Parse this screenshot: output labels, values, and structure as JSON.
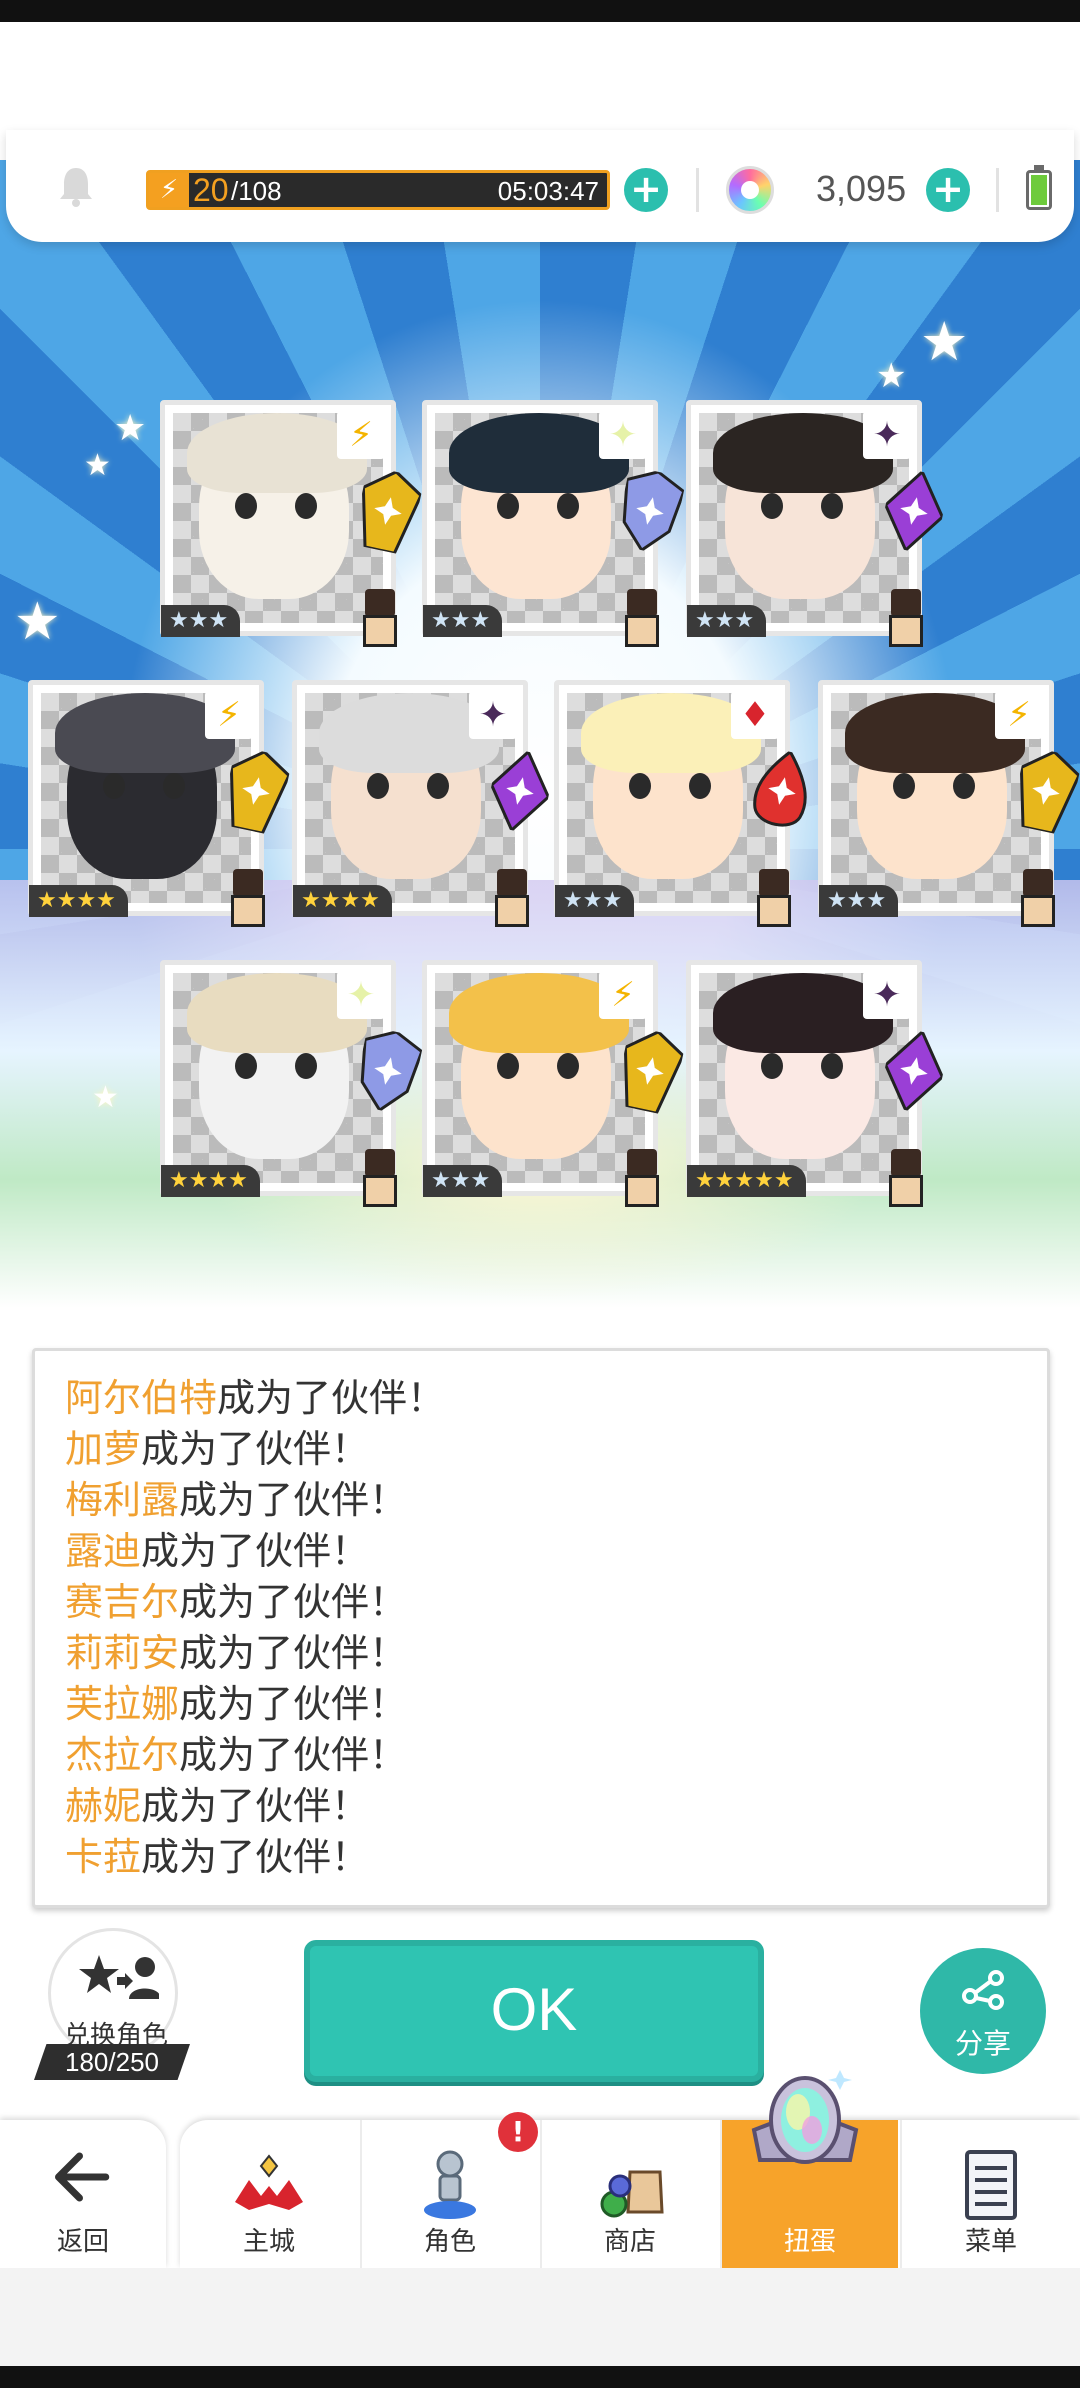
{
  "header": {
    "energy_current": "20",
    "energy_max": "/108",
    "energy_timer": "05:03:47",
    "gem_count": "3,095"
  },
  "colors": {
    "accent_teal": "#2fc4b2",
    "accent_orange": "#f7a32a",
    "name_orange": "#f0a030",
    "star_gold": "#ffd23c"
  },
  "cards": [
    {
      "element": "lightning",
      "stars": "★★★",
      "rarity": 3
    },
    {
      "element": "light",
      "stars": "★★★",
      "rarity": 3
    },
    {
      "element": "dark",
      "stars": "★★★",
      "rarity": 3
    },
    {
      "element": "lightning",
      "stars": "★★★★",
      "rarity": 4
    },
    {
      "element": "dark",
      "stars": "★★★★",
      "rarity": 4
    },
    {
      "element": "fire",
      "stars": "★★★",
      "rarity": 3
    },
    {
      "element": "lightning",
      "stars": "★★★",
      "rarity": 3
    },
    {
      "element": "light",
      "stars": "★★★★",
      "rarity": 4
    },
    {
      "element": "lightning",
      "stars": "★★★",
      "rarity": 3
    },
    {
      "element": "dark",
      "stars": "★★★★★",
      "rarity": 5
    }
  ],
  "log": [
    {
      "name": "阿尔伯特",
      "text": "成为了伙伴！"
    },
    {
      "name": "加萝",
      "text": "成为了伙伴！"
    },
    {
      "name": "梅利露",
      "text": "成为了伙伴！"
    },
    {
      "name": "露迪",
      "text": "成为了伙伴！"
    },
    {
      "name": "赛吉尔",
      "text": "成为了伙伴！"
    },
    {
      "name": "莉莉安",
      "text": "成为了伙伴！"
    },
    {
      "name": "芙拉娜",
      "text": "成为了伙伴！"
    },
    {
      "name": "杰拉尔",
      "text": "成为了伙伴！"
    },
    {
      "name": "赫妮",
      "text": "成为了伙伴！"
    },
    {
      "name": "卡菈",
      "text": "成为了伙伴！"
    }
  ],
  "actions": {
    "convert_label": "兑换角色",
    "convert_count": "180/250",
    "ok_label": "OK",
    "share_label": "分享"
  },
  "nav": {
    "back": "返回",
    "items": [
      "主城",
      "角色",
      "商店",
      "扭蛋",
      "菜单"
    ],
    "active": "扭蛋",
    "alert": "!"
  }
}
